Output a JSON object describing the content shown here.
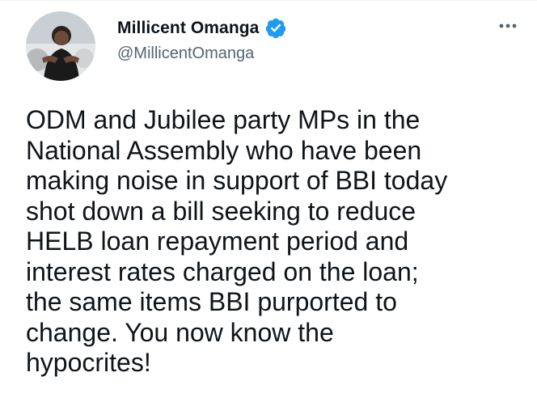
{
  "tweet": {
    "author": {
      "display_name": "Millicent Omanga",
      "handle": "@MillicentOmanga",
      "verified": true,
      "verified_icon": "verified-badge-icon",
      "avatar_icon": "profile-photo"
    },
    "more_icon": "more-options-icon",
    "text": "ODM and Jubilee party MPs in the\nNational Assembly who have been\nmaking noise in support of BBI today\nshot down a bill seeking to reduce\nHELB loan repayment period and\ninterest rates charged on the loan;\nthe same items BBI purported to\nchange. You now know the\nhypocrites!"
  },
  "colors": {
    "verified_blue": "#1d9bf0",
    "text_primary": "#0f1419",
    "text_secondary": "#536471"
  }
}
